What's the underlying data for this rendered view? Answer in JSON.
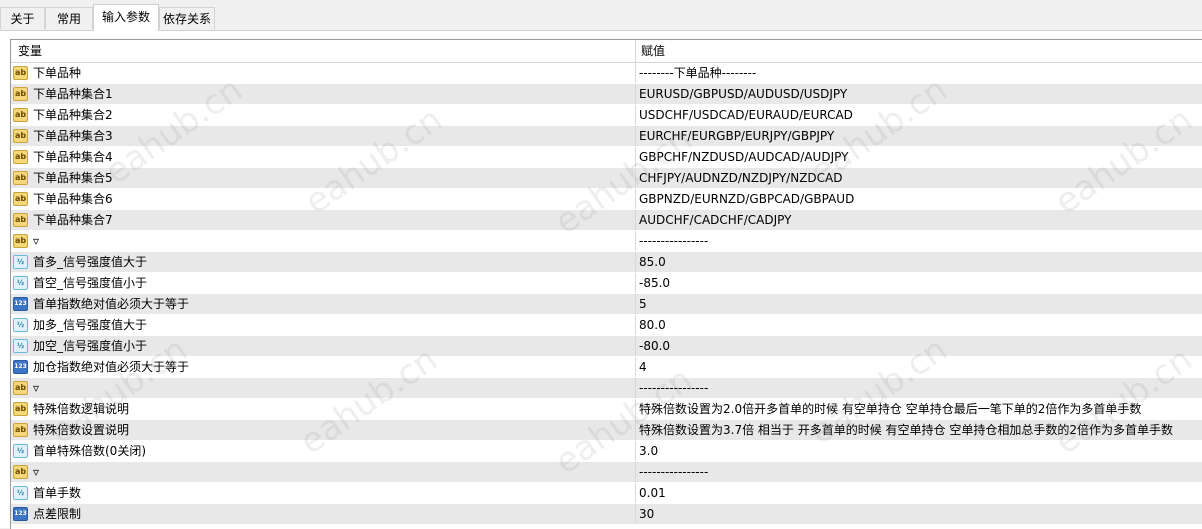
{
  "tabs": [
    {
      "label": "关于"
    },
    {
      "label": "常用"
    },
    {
      "label": "输入参数"
    },
    {
      "label": "依存关系"
    }
  ],
  "table": {
    "headers": {
      "variable": "变量",
      "value": "赋值"
    },
    "rows": [
      {
        "icon": "ab",
        "name": "下单品种",
        "value": "--------下单品种--------"
      },
      {
        "icon": "ab",
        "name": "下单品种集合1",
        "value": "EURUSD/GBPUSD/AUDUSD/USDJPY"
      },
      {
        "icon": "ab",
        "name": "下单品种集合2",
        "value": "USDCHF/USDCAD/EURAUD/EURCAD"
      },
      {
        "icon": "ab",
        "name": "下单品种集合3",
        "value": "EURCHF/EURGBP/EURJPY/GBPJPY"
      },
      {
        "icon": "ab",
        "name": "下单品种集合4",
        "value": "GBPCHF/NZDUSD/AUDCAD/AUDJPY"
      },
      {
        "icon": "ab",
        "name": "下单品种集合5",
        "value": "CHFJPY/AUDNZD/NZDJPY/NZDCAD"
      },
      {
        "icon": "ab",
        "name": "下单品种集合6",
        "value": "GBPNZD/EURNZD/GBPCAD/GBPAUD"
      },
      {
        "icon": "ab",
        "name": "下单品种集合7",
        "value": "AUDCHF/CADCHF/CADJPY"
      },
      {
        "icon": "ab",
        "name": "▿",
        "value": "----------------"
      },
      {
        "icon": "dbl",
        "name": "首多_信号强度值大于",
        "value": "85.0"
      },
      {
        "icon": "dbl",
        "name": "首空_信号强度值小于",
        "value": "-85.0"
      },
      {
        "icon": "int",
        "name": "首单指数绝对值必须大于等于",
        "value": "5"
      },
      {
        "icon": "dbl",
        "name": "加多_信号强度值大于",
        "value": "80.0"
      },
      {
        "icon": "dbl",
        "name": "加空_信号强度值小于",
        "value": "-80.0"
      },
      {
        "icon": "int",
        "name": "加仓指数绝对值必须大于等于",
        "value": "4"
      },
      {
        "icon": "ab",
        "name": "▿",
        "value": "----------------"
      },
      {
        "icon": "ab",
        "name": "特殊倍数逻辑说明",
        "value": "特殊倍数设置为2.0倍开多首单的时候 有空单持仓 空单持仓最后一笔下单的2倍作为多首单手数"
      },
      {
        "icon": "ab",
        "name": "特殊倍数设置说明",
        "value": "特殊倍数设置为3.7倍 相当于 开多首单的时候 有空单持仓 空单持仓相加总手数的2倍作为多首单手数"
      },
      {
        "icon": "dbl",
        "name": "首单特殊倍数(0关闭)",
        "value": "3.0"
      },
      {
        "icon": "ab",
        "name": "▿",
        "value": "----------------"
      },
      {
        "icon": "dbl",
        "name": "首单手数",
        "value": "0.01"
      },
      {
        "icon": "int",
        "name": "点差限制",
        "value": "30"
      }
    ]
  },
  "icons": {
    "ab": "ab",
    "dbl": "½",
    "int": "123"
  },
  "watermark": "eahub.cn"
}
